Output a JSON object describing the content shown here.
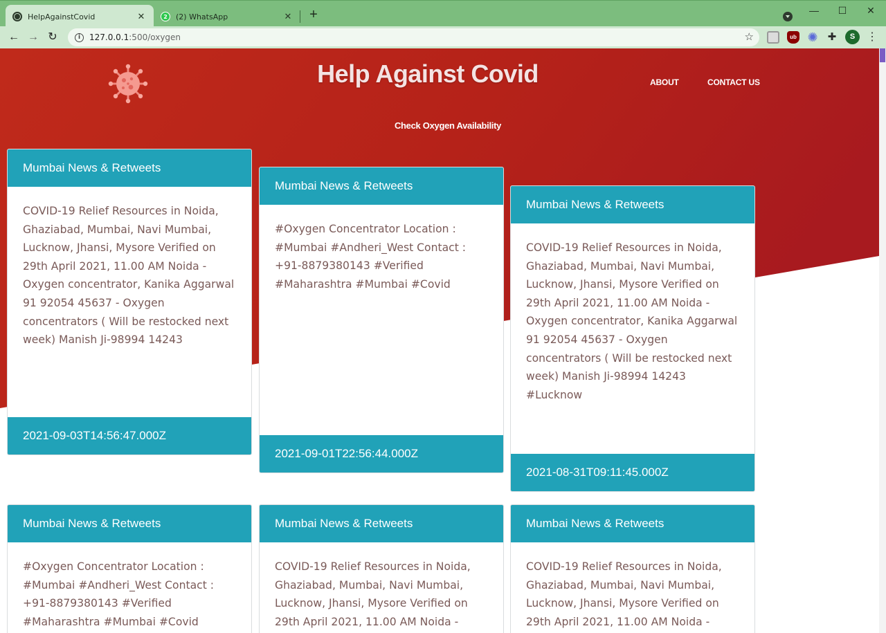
{
  "browser": {
    "tabs": [
      {
        "title": "HelpAgainstCovid",
        "active": true,
        "favicon": "globe-icon"
      },
      {
        "title": "(2) WhatsApp",
        "active": false,
        "favicon": "whatsapp-icon",
        "badge": "2"
      }
    ],
    "url_host": "127.0.0.1",
    "url_path": ":500/oxygen",
    "profile_initial": "S",
    "theme_color": "#7cbd7e"
  },
  "site": {
    "title": "Help Against Covid",
    "nav": {
      "about": "ABOUT",
      "contact": "CONTACT US"
    },
    "subtitle": "Check Oxygen Availability",
    "hero_color": "#b8261c",
    "card_accent": "#21a2b8"
  },
  "cards": [
    {
      "header": "Mumbai News & Retweets",
      "body": "COVID-19 Relief Resources in Noida, Ghaziabad, Mumbai, Navi Mumbai, Lucknow, Jhansi, Mysore Verified on 29th April 2021, 11.00 AM Noida - Oxygen concentrator, Kanika Aggarwal 91 92054 45637 - Oxygen concentrators ( Will be restocked next week) Manish Ji-98994 14243",
      "timestamp": "2021-09-03T14:56:47.000Z"
    },
    {
      "header": "Mumbai News & Retweets",
      "body": "#Oxygen Concentrator Location : #Mumbai #Andheri_West Contact : +91-8879380143 #Verified #Maharashtra #Mumbai #Covid",
      "timestamp": "2021-09-01T22:56:44.000Z"
    },
    {
      "header": "Mumbai News & Retweets",
      "body": "COVID-19 Relief Resources in Noida, Ghaziabad, Mumbai, Navi Mumbai, Lucknow, Jhansi, Mysore Verified on 29th April 2021, 11.00 AM Noida - Oxygen concentrator, Kanika Aggarwal 91 92054 45637 - Oxygen concentrators ( Will be restocked next week) Manish Ji-98994 14243 #Lucknow",
      "timestamp": "2021-08-31T09:11:45.000Z"
    },
    {
      "header": "Mumbai News & Retweets",
      "body": "#Oxygen Concentrator Location : #Mumbai #Andheri_West Contact : +91-8879380143 #Verified #Maharashtra #Mumbai #Covid",
      "timestamp": ""
    },
    {
      "header": "Mumbai News & Retweets",
      "body": "COVID-19 Relief Resources in Noida, Ghaziabad, Mumbai, Navi Mumbai, Lucknow, Jhansi, Mysore Verified on 29th April 2021, 11.00 AM Noida -",
      "timestamp": ""
    },
    {
      "header": "Mumbai News & Retweets",
      "body": "COVID-19 Relief Resources in Noida, Ghaziabad, Mumbai, Navi Mumbai, Lucknow, Jhansi, Mysore Verified on 29th April 2021, 11.00 AM Noida -",
      "timestamp": ""
    }
  ]
}
